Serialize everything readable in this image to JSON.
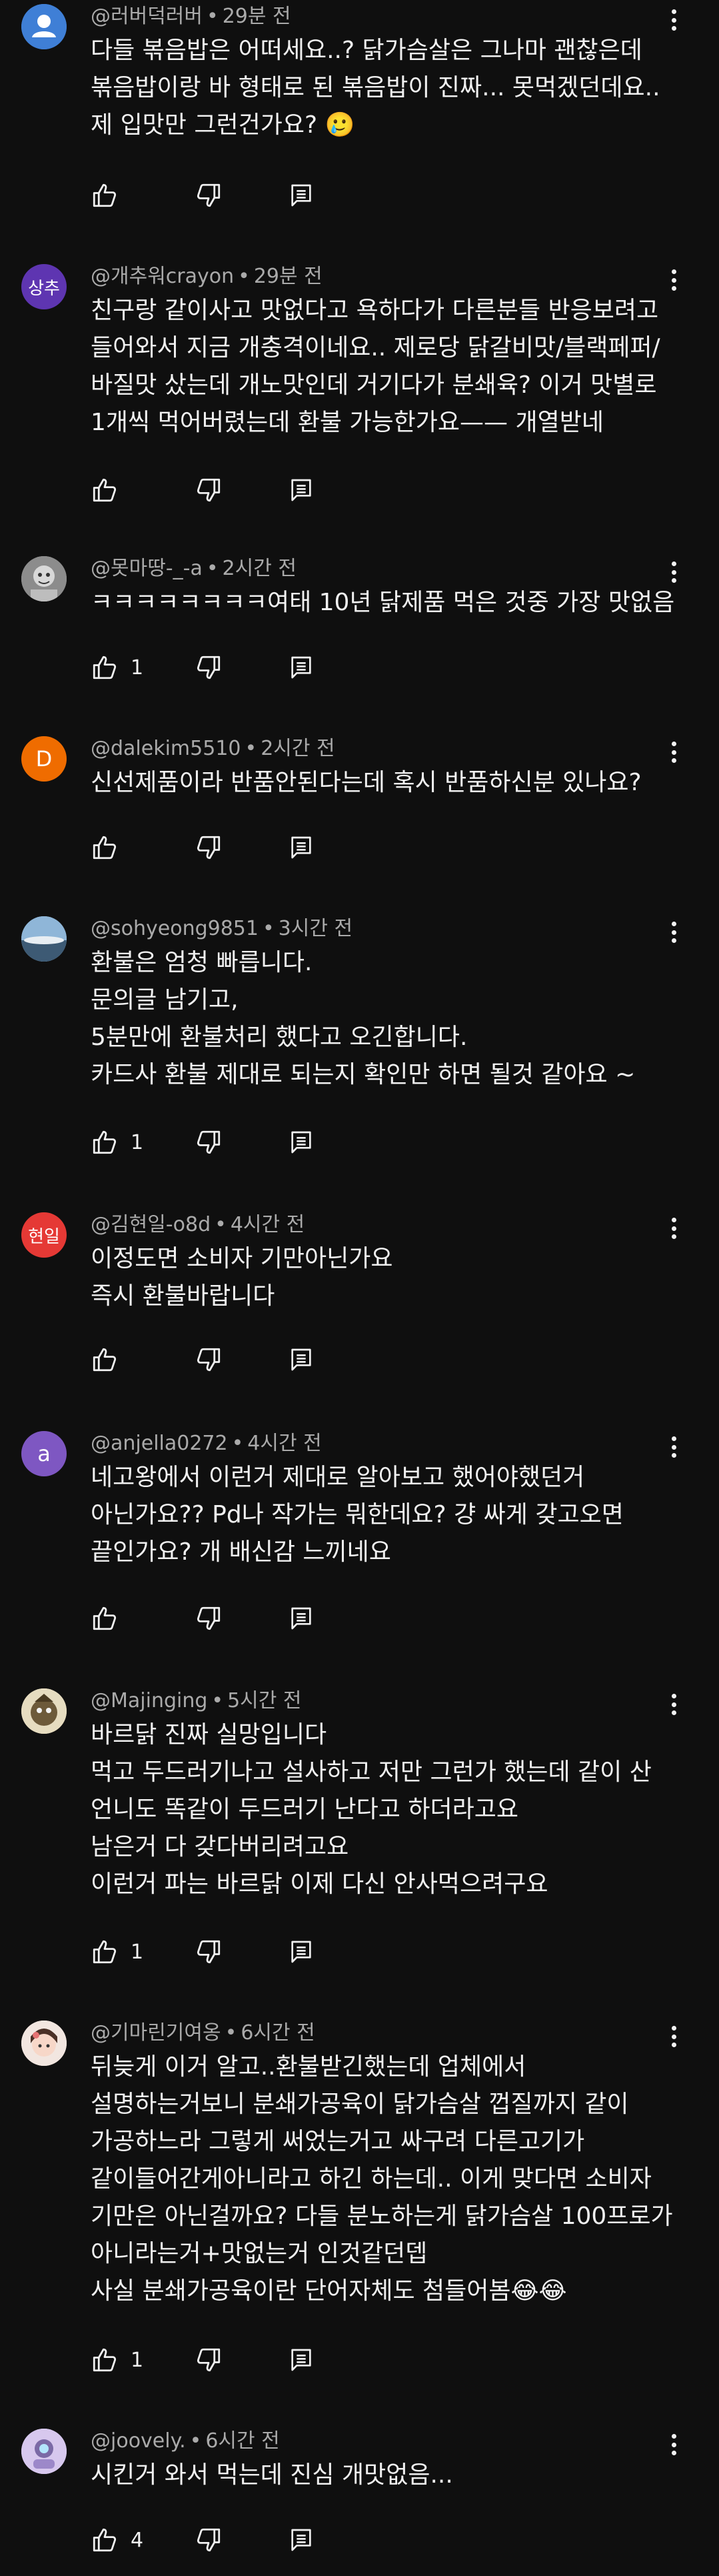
{
  "comments": [
    {
      "author": "@러버덕러버",
      "time": "29분 전",
      "avatar_text": "",
      "avatar_color": "#3f7fd6",
      "avatar_icon": "default-person-icon",
      "lines": [
        "다들 볶음밥은 어떠세요..? 닭가슴살은 그나마 괜찮은데",
        "볶음밥이랑 바 형태로 된 볶음밥이 진짜... 못먹겠던데요..",
        "제 입맛만 그런건가요? 🥲"
      ],
      "likes": ""
    },
    {
      "author": "@개추워crayon",
      "time": "29분 전",
      "avatar_text": "상추",
      "avatar_color": "#5e35b1",
      "avatar_icon": "",
      "lines": [
        "친구랑 같이사고 맛없다고 욕하다가 다른분들 반응보려고",
        "들어와서 지금 개충격이네요.. 제로당 닭갈비맛/블랙페퍼/",
        "바질맛 샀는데 개노맛인데 거기다가 분쇄육? 이거 맛별로",
        "1개씩 먹어버렸는데 환불 가능한가요—— 개열받네"
      ],
      "likes": ""
    },
    {
      "author": "@못마땅-_-a",
      "time": "2시간 전",
      "avatar_text": "",
      "avatar_color": "#9e9e9e",
      "avatar_icon": "photo-avatar-icon",
      "lines": [
        "ㅋㅋㅋㅋㅋㅋㅋㅋ여태 10년 닭제품 먹은 것중 가장 맛없음"
      ],
      "likes": "1"
    },
    {
      "author": "@dalekim5510",
      "time": "2시간 전",
      "avatar_text": "D",
      "avatar_color": "#ef6c00",
      "avatar_icon": "",
      "lines": [
        "신선제품이라 반품안된다는데 혹시 반품하신분 있나요?"
      ],
      "likes": ""
    },
    {
      "author": "@sohyeong9851",
      "time": "3시간 전",
      "avatar_text": "",
      "avatar_color": "#7aa6c9",
      "avatar_icon": "sky-photo-avatar-icon",
      "lines": [
        "환불은 엄청 빠릅니다.",
        "문의글 남기고,",
        "5분만에 환불처리 했다고 오긴합니다.",
        "카드사 환불 제대로 되는지 확인만 하면 될것 같아요 ~"
      ],
      "likes": "1"
    },
    {
      "author": "@김현일-o8d",
      "time": "4시간 전",
      "avatar_text": "현일",
      "avatar_color": "#e53935",
      "avatar_icon": "",
      "lines": [
        "이정도면 소비자 기만아닌가요",
        "즉시 환불바랍니다"
      ],
      "likes": ""
    },
    {
      "author": "@anjella0272",
      "time": "4시간 전",
      "avatar_text": "a",
      "avatar_color": "#7e57c2",
      "avatar_icon": "",
      "lines": [
        "네고왕에서 이런거 제대로 알아보고 했어야했던거",
        "아닌가요?? Pd나 작가는 뭐한데요? 걍 싸게 갖고오면",
        "끝인가요? 개 배신감 느끼네요"
      ],
      "likes": ""
    },
    {
      "author": "@Majinging",
      "time": "5시간 전",
      "avatar_text": "",
      "avatar_color": "#d9c9a3",
      "avatar_icon": "character-avatar-icon",
      "lines": [
        "바르닭 진짜 실망입니다",
        "먹고 두드러기나고 설사하고 저만 그런가 했는데 같이 산",
        "언니도 똑같이 두드러기 난다고 하더라고요",
        "남은거 다 갖다버리려고요",
        "이런거 파는 바르닭 이제 다신 안사먹으려구요"
      ],
      "likes": "1"
    },
    {
      "author": "@기마린기여옹",
      "time": "6시간 전",
      "avatar_text": "",
      "avatar_color": "#e8d6cf",
      "avatar_icon": "doll-avatar-icon",
      "lines": [
        "뒤늦게 이거 알고..환불받긴했는데 업체에서",
        "설명하는거보니 분쇄가공육이 닭가슴살 껍질까지 같이",
        "가공하느라 그렇게 써었는거고 싸구려 다른고기가",
        "같이들어간게아니라고 하긴 하는데.. 이게 맞다면 소비자",
        "기만은 아닌걸까요? 다들 분노하는게 닭가슴살 100프로가",
        "아니라는거+맛없는거 인것같던뎁",
        "사실 분쇄가공육이란 단어자체도 첨들어봄😂😂"
      ],
      "likes": "1"
    },
    {
      "author": "@joovely.",
      "time": "6시간 전",
      "avatar_text": "",
      "avatar_color": "#c9b6e4",
      "avatar_icon": "photo-avatar-icon",
      "lines": [
        "시킨거 와서 먹는데 진심 개맛없음..."
      ],
      "likes": "4"
    }
  ]
}
